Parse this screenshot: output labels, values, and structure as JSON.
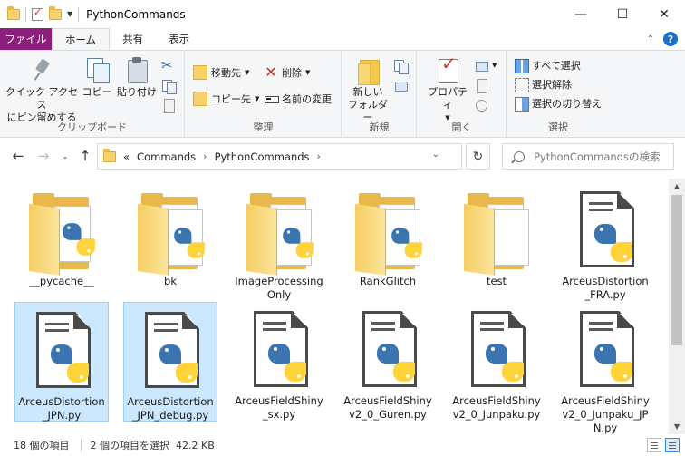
{
  "window": {
    "title": "PythonCommands",
    "minimize_glyph": "—",
    "maximize_glyph": "☐",
    "close_glyph": "✕"
  },
  "tabs": [
    {
      "label": "ファイル"
    },
    {
      "label": "ホーム"
    },
    {
      "label": "共有"
    },
    {
      "label": "表示"
    }
  ],
  "ribbon": {
    "clipboard": {
      "label": "クリップボード",
      "pin_line1": "クイック アクセス",
      "pin_line2": "にピン留めする",
      "copy": "コピー",
      "paste": "貼り付け"
    },
    "organize": {
      "label": "整理",
      "move_to": "移動先",
      "copy_to": "コピー先",
      "delete": "削除",
      "rename": "名前の変更"
    },
    "new": {
      "label": "新規",
      "new_folder_line1": "新しい",
      "new_folder_line2": "フォルダー"
    },
    "open": {
      "label": "開く",
      "properties": "プロパティ"
    },
    "select": {
      "label": "選択",
      "select_all": "すべて選択",
      "select_none": "選択解除",
      "invert_selection": "選択の切り替え"
    }
  },
  "address": {
    "overflow": "«",
    "segments": [
      "Commands",
      "PythonCommands"
    ],
    "search_placeholder": "PythonCommandsの検索"
  },
  "items": [
    {
      "name": "__pycache__",
      "type": "folder-py",
      "selected": false
    },
    {
      "name": "bk",
      "type": "folder-py",
      "selected": false
    },
    {
      "name": "ImageProcessingOnly",
      "type": "folder-py",
      "selected": false
    },
    {
      "name": "RankGlitch",
      "type": "folder-py",
      "selected": false
    },
    {
      "name": "test",
      "type": "folder-empty",
      "selected": false
    },
    {
      "name": "ArceusDistortion_FRA.py",
      "type": "py",
      "selected": false
    },
    {
      "name": "ArceusDistortion_JPN.py",
      "type": "py",
      "selected": true
    },
    {
      "name": "ArceusDistortion_JPN_debug.py",
      "type": "py",
      "selected": true
    },
    {
      "name": "ArceusFieldShiny_sx.py",
      "type": "py",
      "selected": false
    },
    {
      "name": "ArceusFieldShinyv2_0_Guren.py",
      "type": "py",
      "selected": false
    },
    {
      "name": "ArceusFieldShinyv2_0_Junpaku.py",
      "type": "py",
      "selected": false
    },
    {
      "name": "ArceusFieldShinyv2_0_Junpaku_JPN.py",
      "type": "py",
      "selected": false
    }
  ],
  "status": {
    "item_count": "18 個の項目",
    "selection": "2 個の項目を選択  42.2 KB"
  },
  "colors": {
    "file_tab": "#8b1f7a",
    "selection_fill": "#cce8ff",
    "selection_border": "#99d1ff",
    "python_blue": "#3a75b0",
    "python_yellow": "#ffd43b",
    "folder_yellow": "#f5cf63"
  }
}
